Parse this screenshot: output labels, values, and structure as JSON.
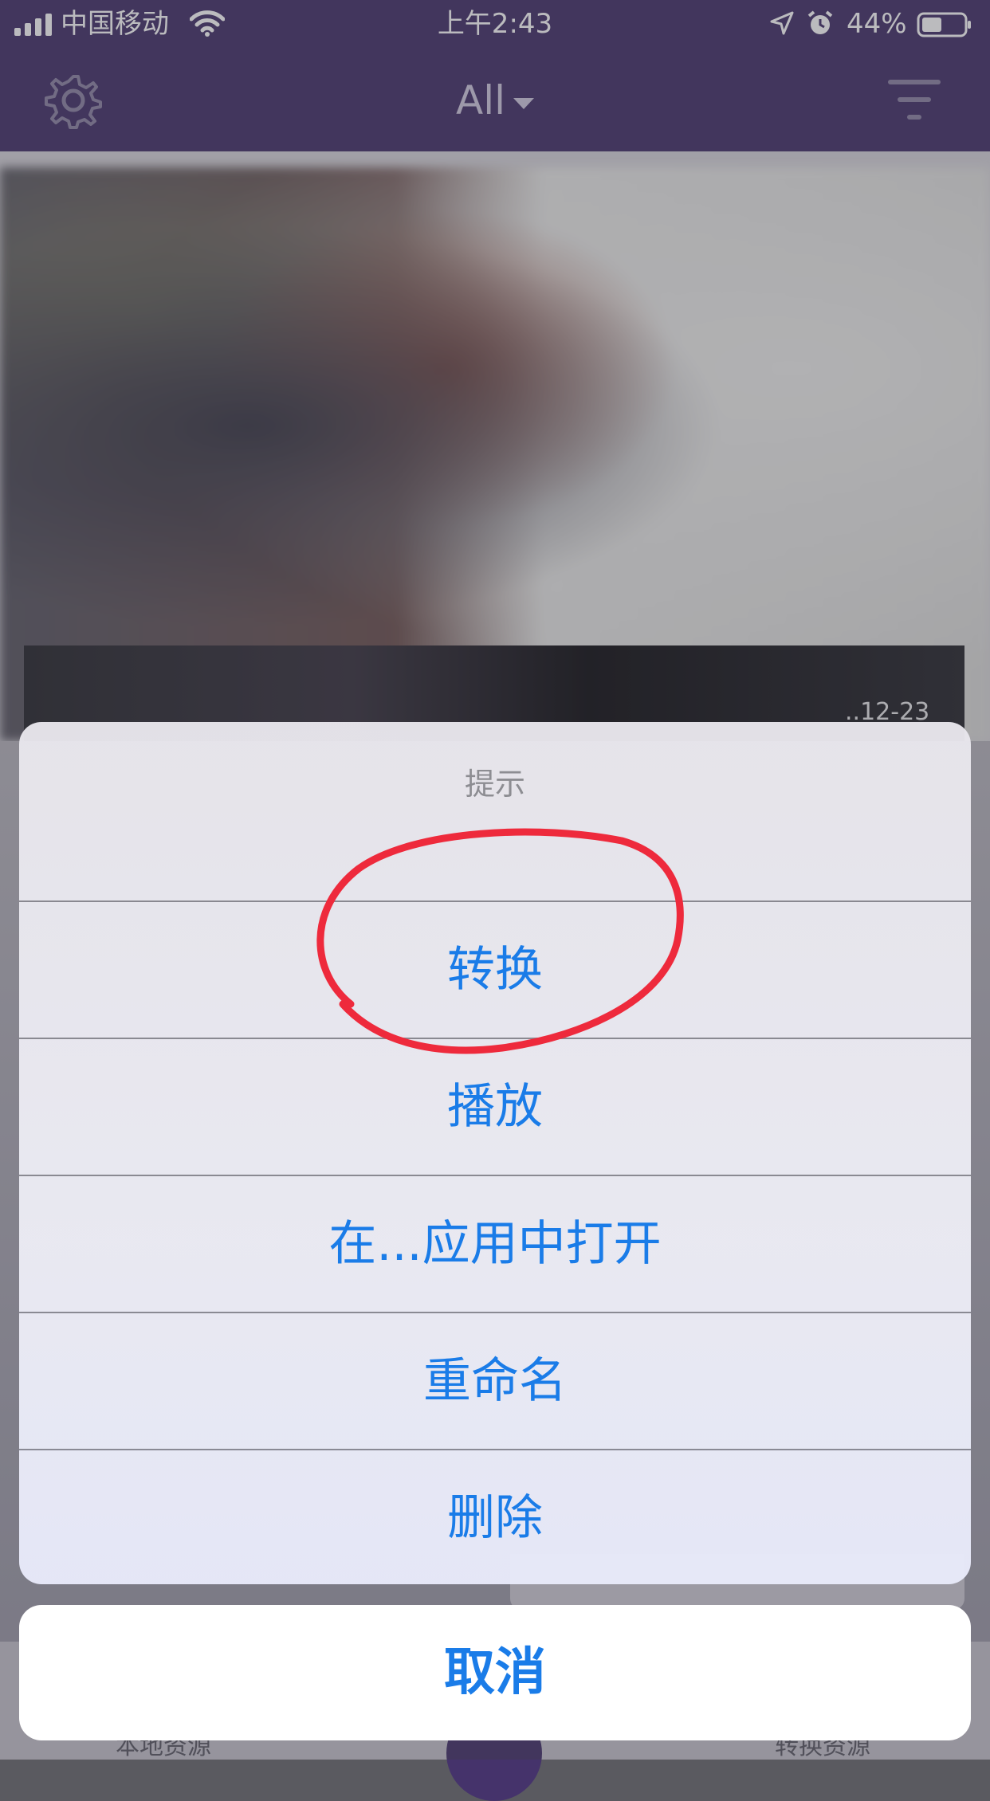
{
  "status_bar": {
    "carrier": "中国移动",
    "time": "上午2:43",
    "battery": "44%"
  },
  "nav": {
    "title": "All"
  },
  "background": {
    "date_label": "..12-23",
    "tabs": [
      "本地资源",
      "转换资源"
    ]
  },
  "action_sheet": {
    "title": "提示",
    "actions": [
      "转换",
      "播放",
      "在...应用中打开",
      "重命名",
      "删除"
    ],
    "cancel": "取消"
  },
  "icons": {
    "signal": "signal-icon",
    "wifi": "wifi-icon",
    "location": "location-arrow-icon",
    "alarm": "alarm-icon",
    "battery": "battery-icon",
    "settings": "gear-icon",
    "filter": "filter-icon",
    "dropdown": "caret-down-icon"
  },
  "colors": {
    "nav_bg": "#45336b",
    "action_text": "#1a7ce8",
    "annotation": "#ee2a3c"
  }
}
